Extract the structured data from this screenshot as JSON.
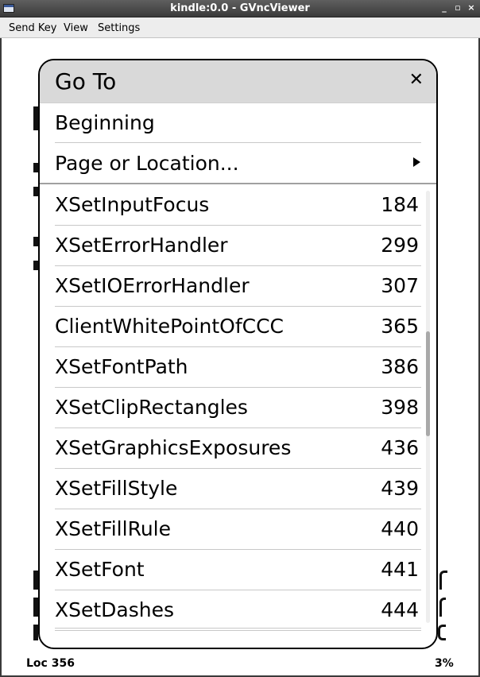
{
  "window": {
    "title": "kindle:0.0 - GVncViewer",
    "buttons": [
      "_",
      "▫",
      "×"
    ]
  },
  "menubar": {
    "send_key": "Send Key",
    "view": "View",
    "settings": "Settings"
  },
  "dialog": {
    "title": "Go To",
    "close_glyph": "✕",
    "options": {
      "beginning": "Beginning",
      "page_or_location": "Page or Location..."
    },
    "entries": [
      {
        "name": "XSetInputFocus",
        "page": "184"
      },
      {
        "name": "XSetErrorHandler",
        "page": "299"
      },
      {
        "name": "XSetIOErrorHandler",
        "page": "307"
      },
      {
        "name": "ClientWhitePointOfCCC",
        "page": "365"
      },
      {
        "name": "XSetFontPath",
        "page": "386"
      },
      {
        "name": "XSetClipRectangles",
        "page": "398"
      },
      {
        "name": "XSetGraphicsExposures",
        "page": "436"
      },
      {
        "name": "XSetFillStyle",
        "page": "439"
      },
      {
        "name": "XSetFillRule",
        "page": "440"
      },
      {
        "name": "XSetFont",
        "page": "441"
      },
      {
        "name": "XSetDashes",
        "page": "444"
      }
    ]
  },
  "footer": {
    "location": "Loc 356",
    "percent": "3%"
  }
}
